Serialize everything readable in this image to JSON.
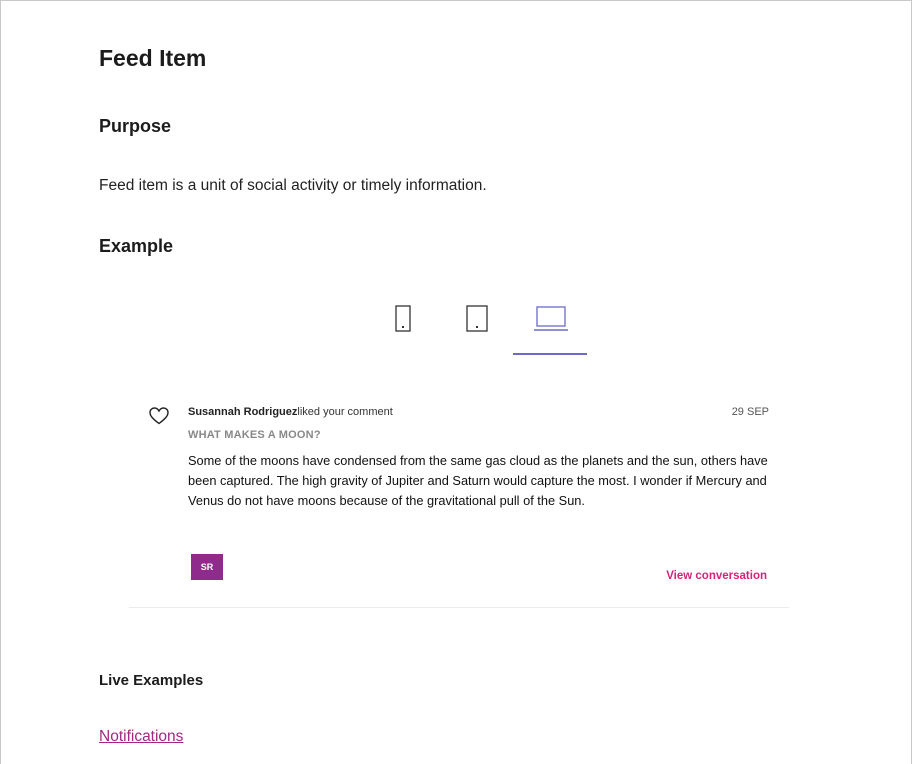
{
  "page": {
    "title": "Feed Item",
    "purpose_heading": "Purpose",
    "purpose_text": "Feed item is a unit of social activity or timely information.",
    "example_heading": "Example",
    "live_heading": "Live Examples",
    "notifications_link": "Notifications"
  },
  "device_tabs": [
    {
      "icon": "phone-icon",
      "active": false
    },
    {
      "icon": "tablet-icon",
      "active": false
    },
    {
      "icon": "laptop-icon",
      "active": true
    }
  ],
  "feed_item": {
    "user": "Susannah Rodriguez",
    "action": "liked your comment",
    "date": "29 SEP",
    "subject": "WHAT MAKES A MOON?",
    "body": "Some of the moons have condensed from the same gas cloud as the planets and the sun, others have been captured. The high gravity of Jupiter and Saturn would capture the most. I wonder if Mercury and Venus do not have moons because of the gravitational pull of the Sun.",
    "avatar_initials": "SR",
    "view_link": "View conversation"
  },
  "colors": {
    "accent_pink": "#d4237a",
    "avatar_purple": "#8e2b8c",
    "active_tab": "#6b6bc6",
    "link": "#a3287f"
  }
}
